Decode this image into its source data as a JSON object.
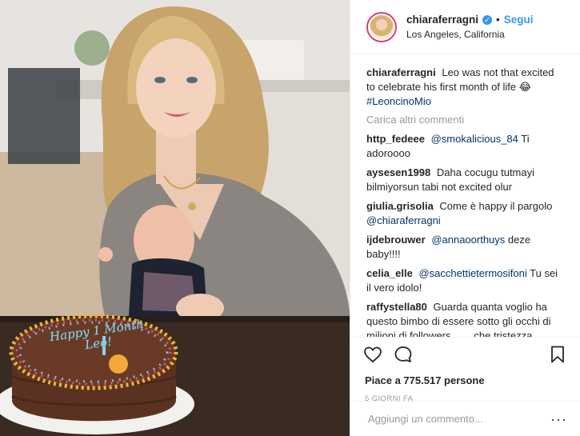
{
  "header": {
    "username": "chiaraferragni",
    "separator": "•",
    "follow_label": "Segui",
    "location": "Los Angeles, California"
  },
  "photo": {
    "cake_text": "Happy 1 Month Leo!"
  },
  "caption": {
    "user": "chiaraferragni",
    "text": "Leo was not that excited to celebrate his first month of life 😂",
    "hashtag": "#LeoncinoMio"
  },
  "load_more": "Carica altri commenti",
  "comments": [
    {
      "user": "http_fedeee",
      "mention": "@smokalicious_84",
      "text": "Ti adoroooo"
    },
    {
      "user": "aysesen1998",
      "mention": "",
      "text": "Daha cocugu tutmayi bilmiyorsun tabi not excited olur"
    },
    {
      "user": "giulia.grisolia",
      "mention": "",
      "text": "Come è happy il pargolo",
      "mention_after": "@chiaraferragni"
    },
    {
      "user": "ijdebrouwer",
      "mention": "@annaoorthuys",
      "text": "deze baby!!!!"
    },
    {
      "user": "celia_elle",
      "mention": "@sacchettietermosifoni",
      "text": "Tu sei il vero idolo!"
    },
    {
      "user": "raffystella80",
      "mention": "",
      "text": "Guarda quanta voglio ha questo bimbo di essere sotto gli occhi di milioni di followers ...... che tristezza."
    }
  ],
  "likes": "Piace a 775.517 persone",
  "time": "5 GIORNI FA",
  "add_comment": {
    "placeholder": "Aggiungi un commento...",
    "more": "···"
  },
  "icons": [
    "heart-icon",
    "comment-icon",
    "bookmark-icon",
    "verified-icon"
  ],
  "colors": {
    "link": "#3897f0",
    "mention": "#003569",
    "muted": "#999999",
    "text": "#262626"
  }
}
